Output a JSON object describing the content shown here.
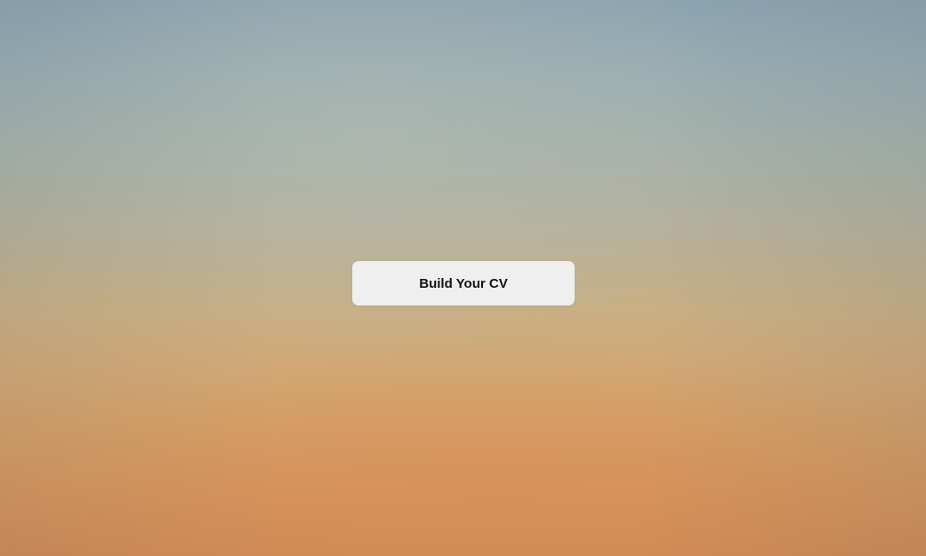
{
  "main": {
    "cta_label": "Build Your CV"
  },
  "colors": {
    "sky_top": "#8ca3b1",
    "sky_bottom": "#cf8a55",
    "button_bg": "#efefef",
    "button_text": "#111111"
  }
}
